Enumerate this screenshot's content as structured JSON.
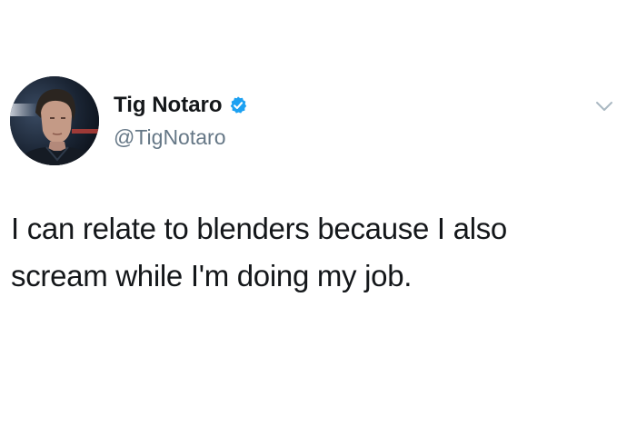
{
  "tweet": {
    "author": {
      "display_name": "Tig Notaro",
      "handle": "@TigNotaro",
      "verified": true,
      "avatar_icon": "profile-photo"
    },
    "text_lines": [
      "I can relate to blenders because I also",
      "scream while I'm doing my job."
    ],
    "menu_icon": "chevron-down-icon"
  },
  "colors": {
    "name": "#14171a",
    "handle": "#657786",
    "verified": "#1da1f2",
    "caret": "#aab8c2",
    "background": "#ffffff"
  }
}
